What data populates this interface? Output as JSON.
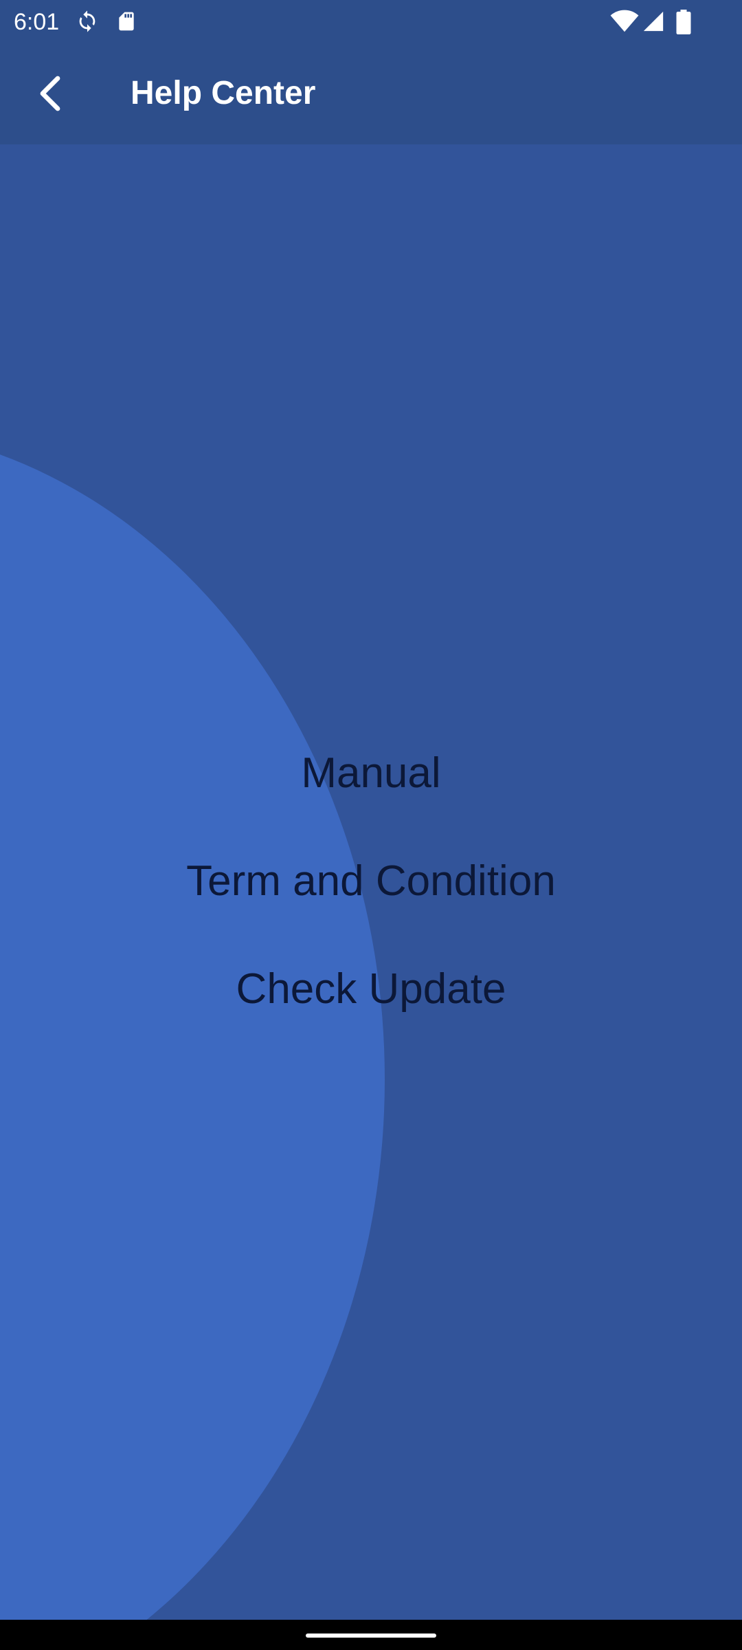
{
  "status_bar": {
    "time": "6:01",
    "icons": [
      "sync-icon",
      "sd-card-icon",
      "wifi-icon",
      "signal-icon",
      "battery-icon"
    ]
  },
  "app_bar": {
    "back_icon": "back-arrow-icon",
    "title": "Help Center"
  },
  "menu": {
    "items": [
      {
        "label": "Manual"
      },
      {
        "label": "Term and Condition"
      },
      {
        "label": "Check Update"
      }
    ]
  },
  "colors": {
    "background": "#32549a",
    "app_bar": "#2d4e8b",
    "decorative_circle": "#3d69c1",
    "menu_text": "#0c1838"
  }
}
